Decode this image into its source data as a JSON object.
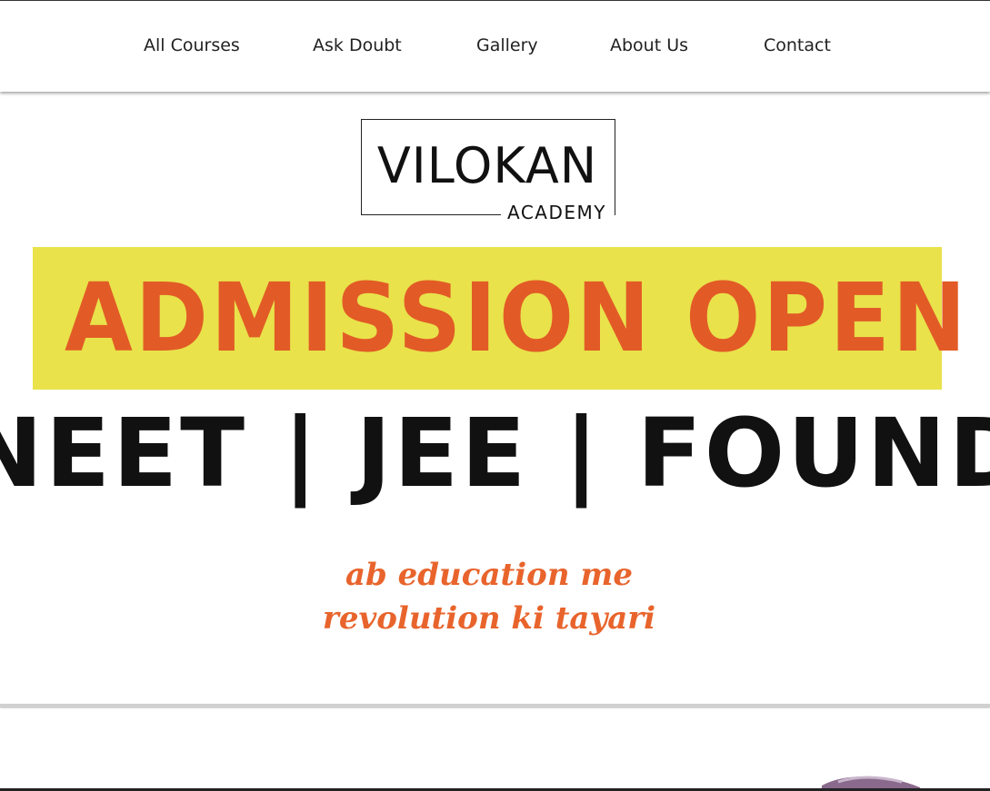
{
  "nav": {
    "items": [
      {
        "label": "All Courses"
      },
      {
        "label": "Ask Doubt"
      },
      {
        "label": "Gallery"
      },
      {
        "label": "About Us"
      },
      {
        "label": "Contact"
      }
    ]
  },
  "hero": {
    "logo": {
      "title": "VILOKAN",
      "subtitle": "ACADEMY"
    },
    "banner": {
      "text": "ADMISSION OPEN",
      "background_color": "#e9e24b",
      "text_color": "#e25b26"
    },
    "exams": "NEET | JEE | FOUNDATION",
    "tagline": {
      "line1": "ab education me",
      "line2": "revolution ki tayari",
      "color": "#e8642c"
    }
  }
}
